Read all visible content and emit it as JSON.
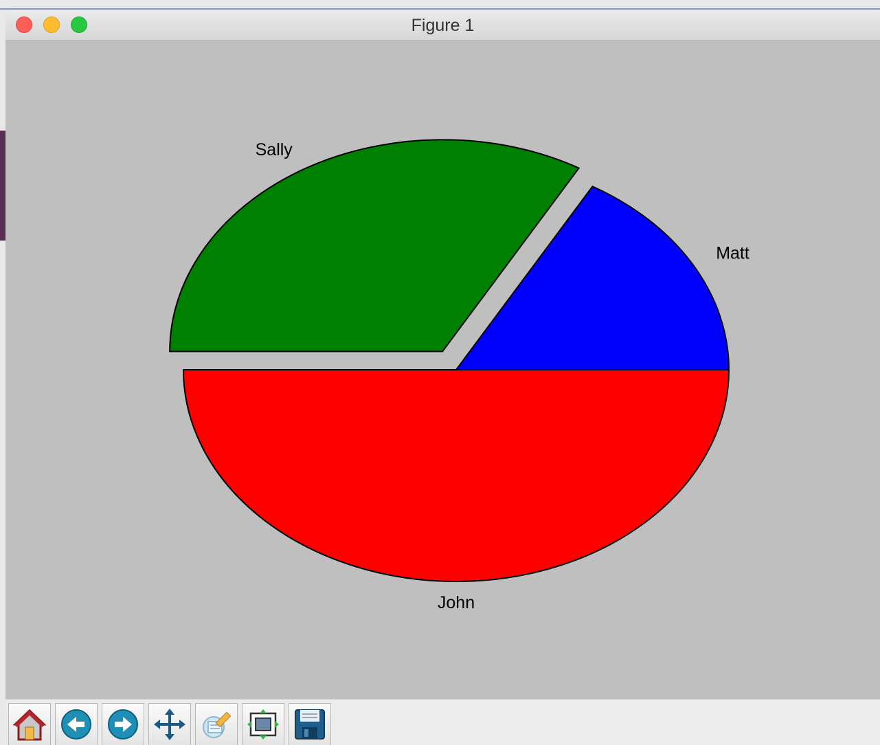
{
  "window": {
    "title": "Figure 1"
  },
  "toolbar": {
    "tools": [
      {
        "name": "home",
        "icon": "home-icon"
      },
      {
        "name": "back",
        "icon": "arrow-left-icon"
      },
      {
        "name": "forward",
        "icon": "arrow-right-icon"
      },
      {
        "name": "pan",
        "icon": "move-icon"
      },
      {
        "name": "zoom",
        "icon": "zoom-rect-icon"
      },
      {
        "name": "subplots",
        "icon": "subplots-icon"
      },
      {
        "name": "save",
        "icon": "floppy-disk-icon"
      }
    ]
  },
  "chart_data": {
    "type": "pie",
    "labels": [
      "Matt",
      "Sally",
      "John"
    ],
    "values": [
      1,
      2,
      3
    ],
    "colors": [
      "#0000ff",
      "#008000",
      "#ff0000"
    ],
    "explode": [
      0,
      0.1,
      0
    ],
    "start_angle": 0,
    "edge_color": "#000000",
    "background": "#bfbfbf"
  }
}
